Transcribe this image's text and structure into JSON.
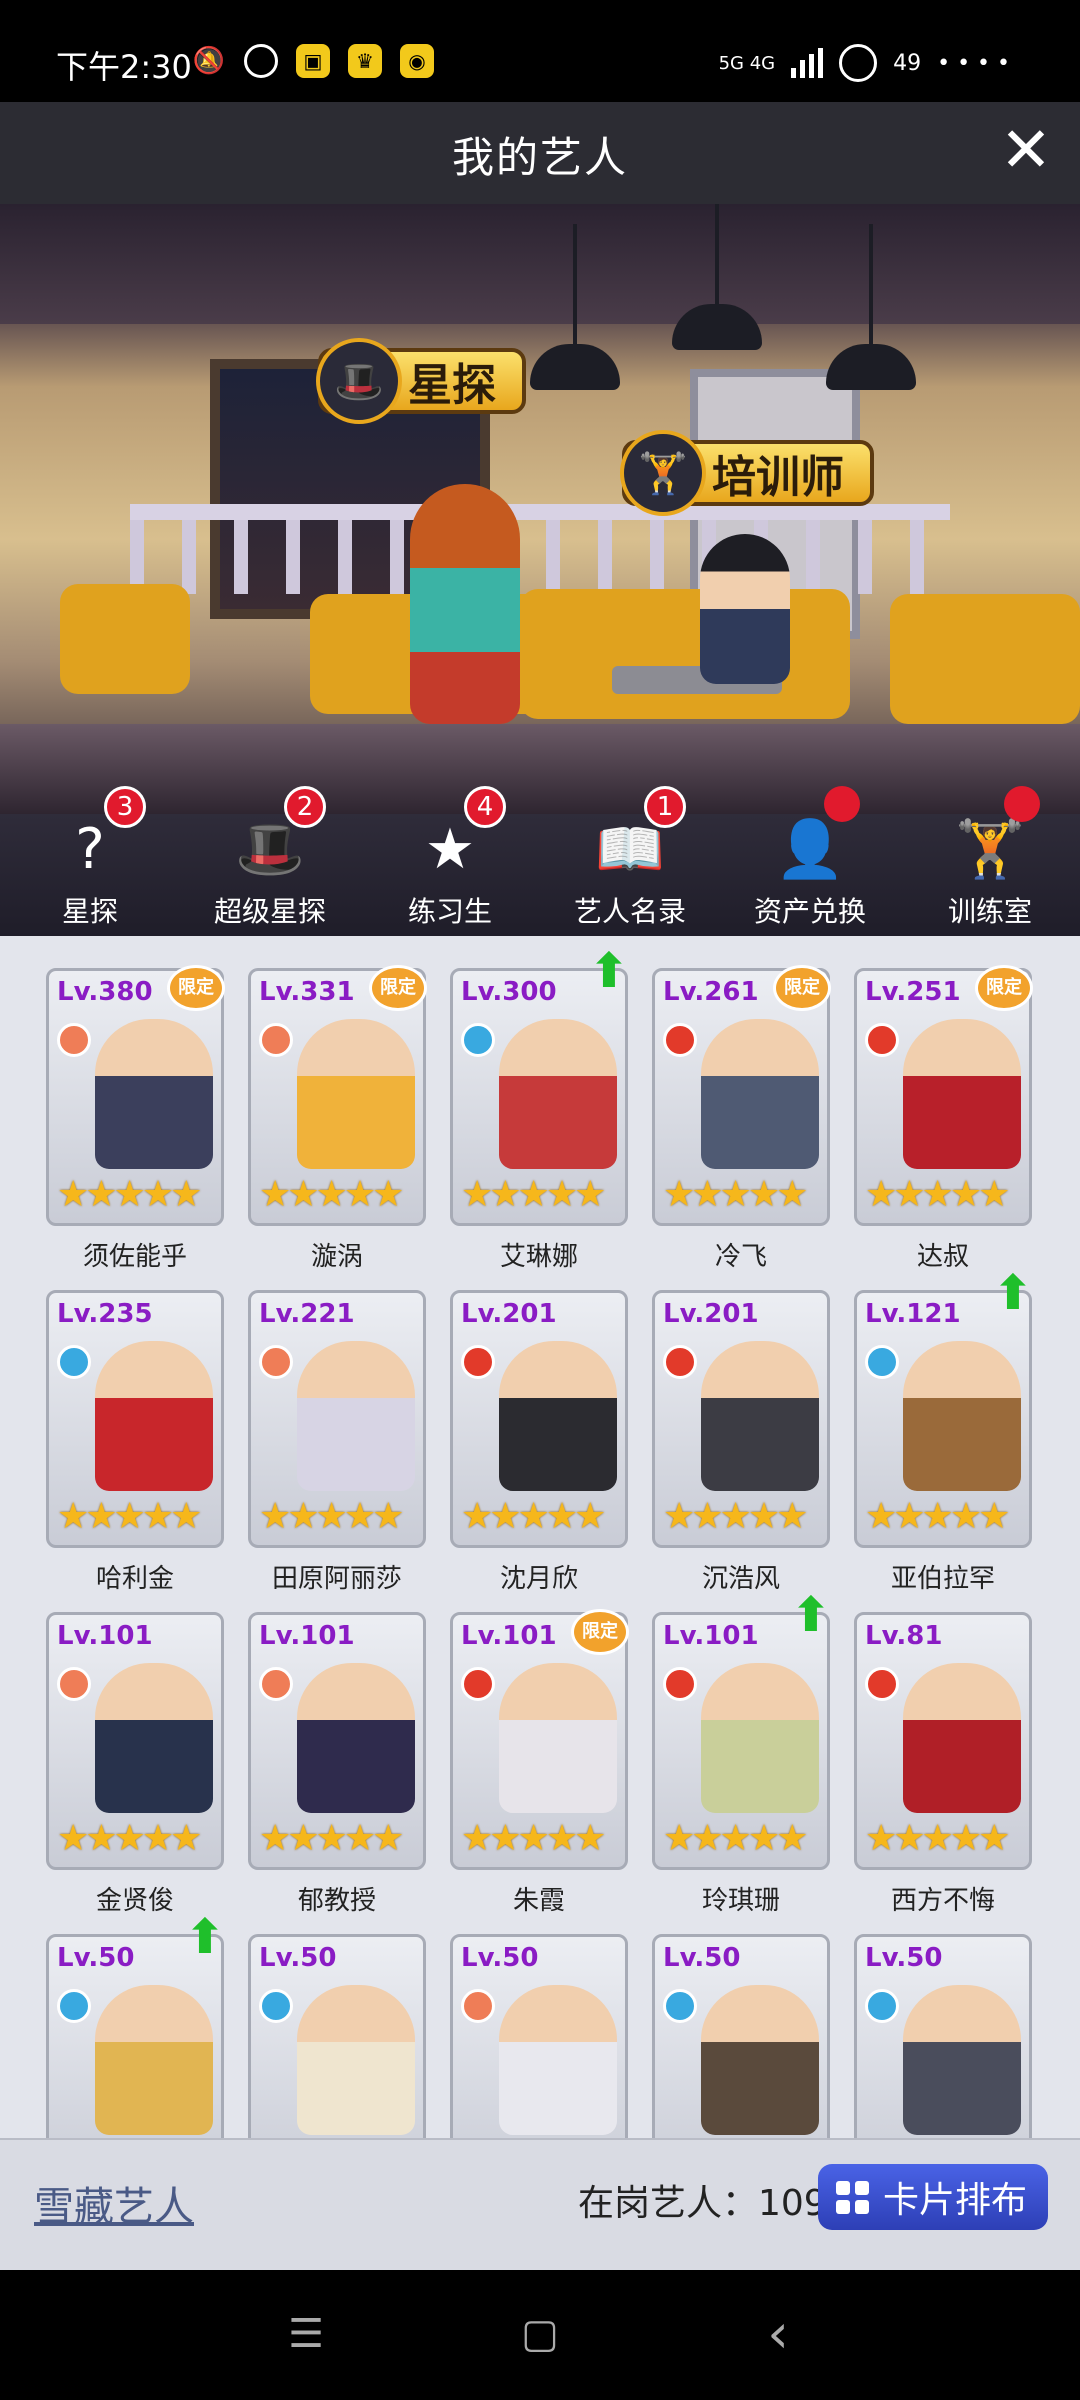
{
  "status_bar": {
    "time": "下午2:30",
    "network": "5G 4G",
    "battery": "49",
    "more": "• • • •"
  },
  "header": {
    "title": "我的艺人",
    "close_glyph": "✕"
  },
  "scene": {
    "scout_label": "星探",
    "trainer_label": "培训师"
  },
  "menu": [
    {
      "label": "星探",
      "badge": "3",
      "icon": "scout-hat-icon",
      "glyph": "?"
    },
    {
      "label": "超级星探",
      "badge": "2",
      "icon": "gold-hat-icon",
      "glyph": "🎩"
    },
    {
      "label": "练习生",
      "badge": "4",
      "icon": "star-icon",
      "glyph": "★"
    },
    {
      "label": "艺人名录",
      "badge": "1",
      "icon": "book-icon",
      "glyph": "📖"
    },
    {
      "label": "资产兑换",
      "badge": "",
      "icon": "silhouette-icon",
      "glyph": "👤"
    },
    {
      "label": "训练室",
      "badge": "",
      "icon": "dumbbell-icon",
      "glyph": "🏋"
    }
  ],
  "artists": [
    {
      "level": "Lv.380",
      "name": "须佐能乎",
      "tag": "限定",
      "up": false,
      "ring": "#ef7d57",
      "skin": "#3b3f5c"
    },
    {
      "level": "Lv.331",
      "name": "漩涡",
      "tag": "限定",
      "up": false,
      "ring": "#ef7d57",
      "skin": "#f0b23a"
    },
    {
      "level": "Lv.300",
      "name": "艾琳娜",
      "tag": "",
      "up": true,
      "ring": "#39a9e0",
      "skin": "#c63a3a"
    },
    {
      "level": "Lv.261",
      "name": "冷飞",
      "tag": "限定",
      "up": false,
      "ring": "#e23a2a",
      "skin": "#4f5a73"
    },
    {
      "level": "Lv.251",
      "name": "达叔",
      "tag": "限定",
      "up": false,
      "ring": "#e23a2a",
      "skin": "#b8202a"
    },
    {
      "level": "Lv.235",
      "name": "哈利金",
      "tag": "",
      "up": false,
      "ring": "#39a9e0",
      "skin": "#c8262b"
    },
    {
      "level": "Lv.221",
      "name": "田原阿丽莎",
      "tag": "",
      "up": false,
      "ring": "#ef7d57",
      "skin": "#d7d4e4"
    },
    {
      "level": "Lv.201",
      "name": "沈月欣",
      "tag": "",
      "up": false,
      "ring": "#e23a2a",
      "skin": "#2b2b30"
    },
    {
      "level": "Lv.201",
      "name": "沉浩风",
      "tag": "",
      "up": false,
      "ring": "#e23a2a",
      "skin": "#3c3c44"
    },
    {
      "level": "Lv.121",
      "name": "亚伯拉罕",
      "tag": "",
      "up": true,
      "ring": "#39a9e0",
      "skin": "#9a6a3a"
    },
    {
      "level": "Lv.101",
      "name": "金贤俊",
      "tag": "",
      "up": false,
      "ring": "#ef7d57",
      "skin": "#28324c"
    },
    {
      "level": "Lv.101",
      "name": "郁教授",
      "tag": "",
      "up": false,
      "ring": "#ef7d57",
      "skin": "#2f2b4d"
    },
    {
      "level": "Lv.101",
      "name": "朱霞",
      "tag": "限定",
      "up": false,
      "ring": "#e23a2a",
      "skin": "#e7e4ea"
    },
    {
      "level": "Lv.101",
      "name": "玲琪珊",
      "tag": "",
      "up": true,
      "ring": "#e23a2a",
      "skin": "#c9cf9a"
    },
    {
      "level": "Lv.81",
      "name": "西方不悔",
      "tag": "",
      "up": false,
      "ring": "#e23a2a",
      "skin": "#b01f27"
    },
    {
      "level": "Lv.50",
      "name": "",
      "tag": "",
      "up": true,
      "ring": "#39a9e0",
      "skin": "#e1b552"
    },
    {
      "level": "Lv.50",
      "name": "",
      "tag": "",
      "up": false,
      "ring": "#39a9e0",
      "skin": "#efe5cf"
    },
    {
      "level": "Lv.50",
      "name": "",
      "tag": "",
      "up": false,
      "ring": "#ef7d57",
      "skin": "#e8e8ee"
    },
    {
      "level": "Lv.50",
      "name": "",
      "tag": "",
      "up": false,
      "ring": "#39a9e0",
      "skin": "#5a4a3c"
    },
    {
      "level": "Lv.50",
      "name": "",
      "tag": "",
      "up": false,
      "ring": "#39a9e0",
      "skin": "#4a4d5c"
    }
  ],
  "stars": "★★★★★",
  "bottom": {
    "hidden_artists": "雪藏艺人",
    "active_label": "在岗艺人：109",
    "sort_button": "卡片排布"
  },
  "nav": {
    "menu_glyph": "☰",
    "home_glyph": "▢",
    "back_glyph": "‹"
  },
  "colors": {
    "level_text": "#8a1cc4",
    "star": "#f6b71b",
    "badge": "#e11a2d",
    "sort_button": "#3a52d6",
    "up_arrow": "#1fbf2b"
  }
}
